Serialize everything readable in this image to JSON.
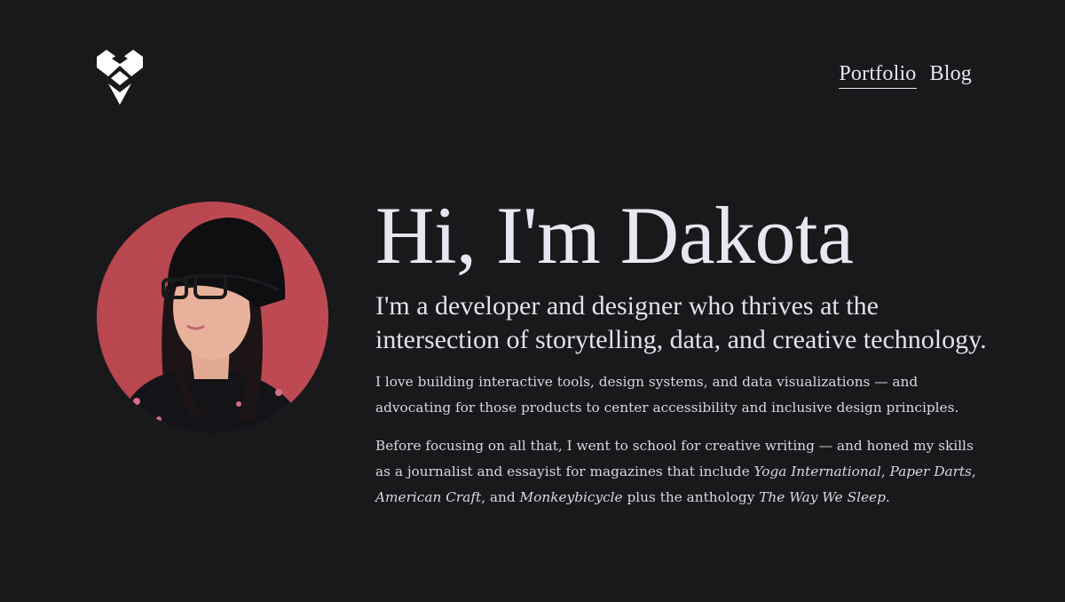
{
  "brand": {
    "logo_icon": "geometric-diamond-logo-icon"
  },
  "nav": {
    "items": [
      {
        "label": "Portfolio",
        "active": true
      },
      {
        "label": "Blog",
        "active": false
      }
    ]
  },
  "profile": {
    "photo_alt": "Portrait photo"
  },
  "hero": {
    "headline": "Hi, I'm Dakota",
    "lead": "I'm a developer and designer who thrives at the intersection of storytelling, data, and creative technology.",
    "paragraph_1": "I love building interactive tools, design systems, and data visualizations — and advocating for those products to center accessibility and inclusive design principles.",
    "paragraph_2": {
      "text_1": "Before focusing on all that, I went to school for creative writing — and honed my skills as a journalist and essayist for magazines that include ",
      "pub_1": "Yoga International",
      "sep_1": ", ",
      "pub_2": "Paper Darts",
      "sep_2": ", ",
      "pub_3": "American Craft",
      "sep_3": ", and ",
      "pub_4": "Monkeybicycle",
      "sep_4": " plus the anthology ",
      "pub_5": "The Way We Sleep",
      "end": "."
    }
  },
  "colors": {
    "background": "#19181b",
    "text": "#e8e6f0",
    "photo_backdrop": "#b8474f"
  }
}
